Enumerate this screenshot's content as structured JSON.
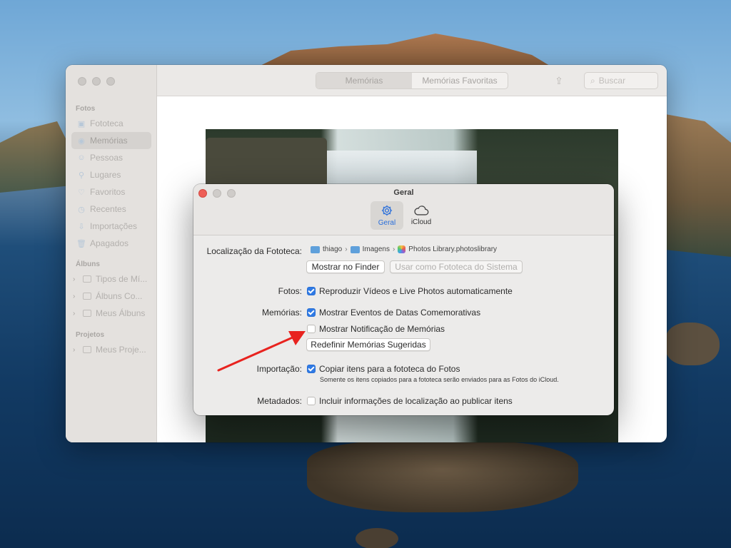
{
  "sidebar": {
    "sections": [
      {
        "title": "Fotos"
      },
      {
        "title": "Álbuns"
      },
      {
        "title": "Projetos"
      }
    ],
    "fotos_items": [
      {
        "label": "Fototeca",
        "icon": "photo-library-icon"
      },
      {
        "label": "Memórias",
        "icon": "memories-icon"
      },
      {
        "label": "Pessoas",
        "icon": "people-icon"
      },
      {
        "label": "Lugares",
        "icon": "places-icon"
      },
      {
        "label": "Favoritos",
        "icon": "heart-icon"
      },
      {
        "label": "Recentes",
        "icon": "clock-icon"
      },
      {
        "label": "Importações",
        "icon": "import-icon"
      },
      {
        "label": "Apagados",
        "icon": "trash-icon"
      }
    ],
    "albums_items": [
      {
        "label": "Tipos de Mí..."
      },
      {
        "label": "Álbuns Co..."
      },
      {
        "label": "Meus Álbuns"
      }
    ],
    "projects_items": [
      {
        "label": "Meus Proje..."
      }
    ]
  },
  "toolbar": {
    "tabs": [
      {
        "label": "Memórias",
        "active": true
      },
      {
        "label": "Memórias Favoritas",
        "active": false
      }
    ],
    "search_placeholder": "Buscar"
  },
  "dialog": {
    "title": "Geral",
    "tabs": [
      {
        "label": "Geral",
        "icon": "gear-icon",
        "active": true
      },
      {
        "label": "iCloud",
        "icon": "cloud-icon",
        "active": false
      }
    ],
    "library_location": {
      "label": "Localização da Fototeca:",
      "path": [
        "thiago",
        "Imagens",
        "Photos Library.photoslibrary"
      ],
      "show_in_finder": "Mostrar no Finder",
      "use_as_system": "Usar como Fototeca do Sistema"
    },
    "photos": {
      "label": "Fotos:",
      "option": "Reproduzir Vídeos e Live Photos automaticamente",
      "checked": true
    },
    "memories": {
      "label": "Memórias:",
      "option1": "Mostrar Eventos de Datas Comemorativas",
      "option1_checked": true,
      "option2": "Mostrar Notificação de Memórias",
      "option2_checked": false,
      "reset_button": "Redefinir Memórias Sugeridas"
    },
    "importing": {
      "label": "Importação:",
      "option": "Copiar itens para a fototeca do Fotos",
      "checked": true,
      "note": "Somente os itens copiados para a fototeca serão enviados para as Fotos do iCloud."
    },
    "metadata": {
      "label": "Metadados:",
      "option": "Incluir informações de localização ao publicar itens",
      "checked": false
    }
  },
  "colors": {
    "accent": "#2f7ae5",
    "close_button": "#ee5e56",
    "arrow": "#e8231f"
  }
}
